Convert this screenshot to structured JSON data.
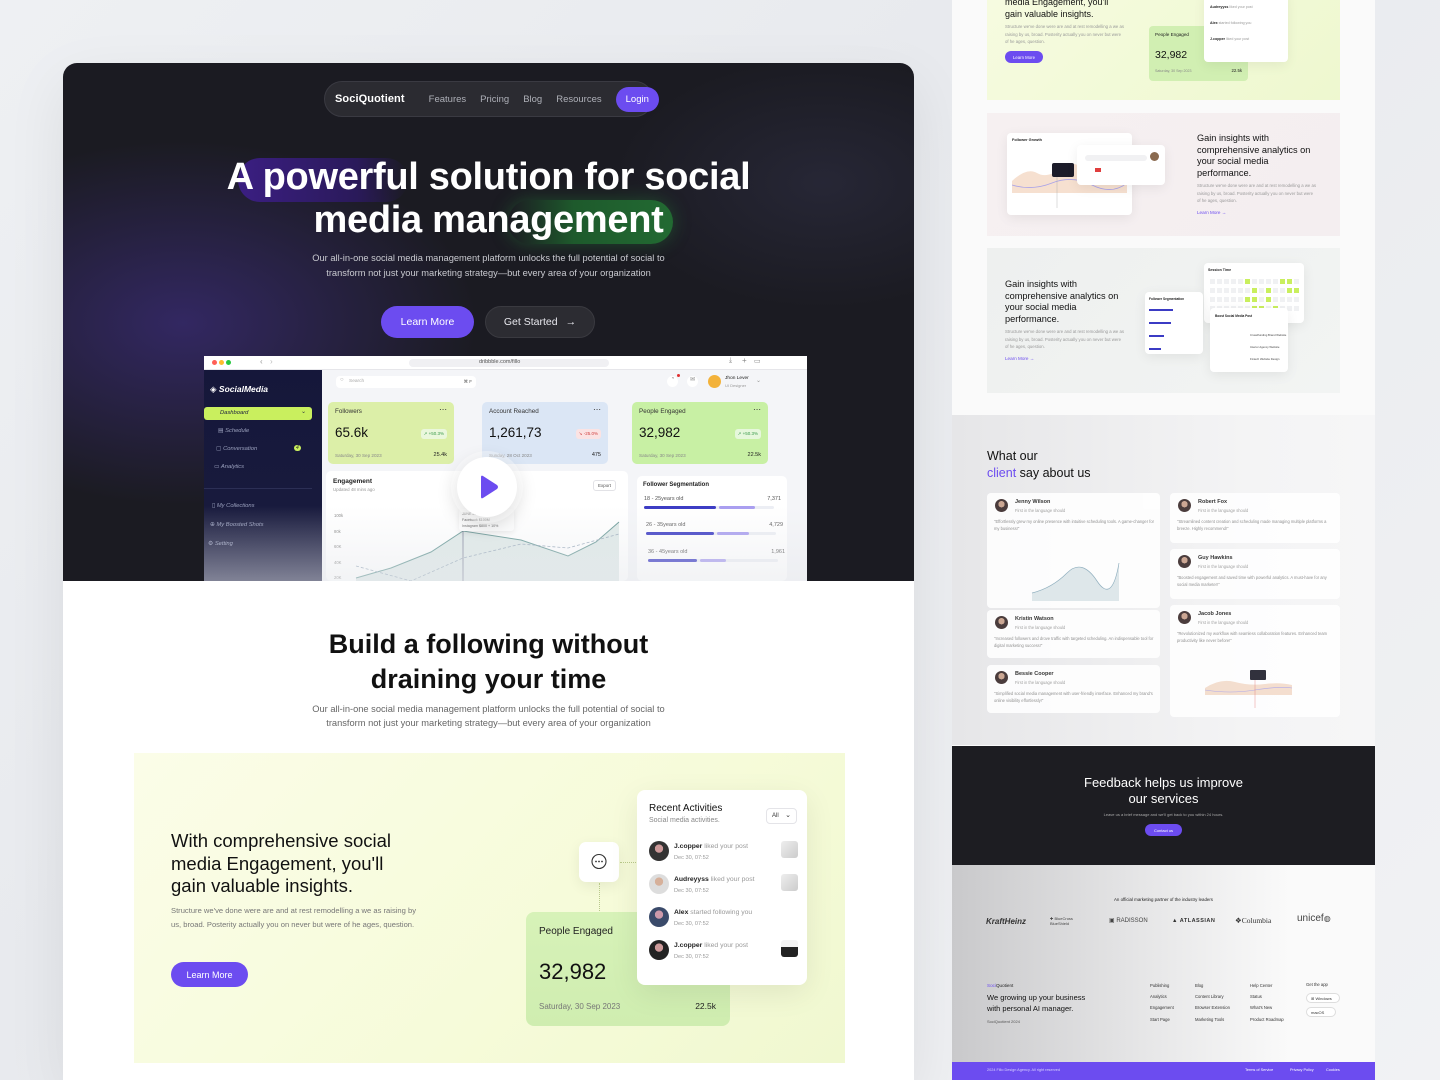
{
  "left_page": {
    "nav": {
      "brand": "SociQuotient",
      "links": [
        "Features",
        "Pricing",
        "Blog",
        "Resources"
      ],
      "login": "Login"
    },
    "hero": {
      "title_line1": "A powerful solution for social",
      "title_line2": "media management",
      "subtitle_line1": "Our all-in-one social media management platform unlocks the full potential of social to",
      "subtitle_line2": "transform not just your marketing strategy—but every area of your organization",
      "learn_more": "Learn More",
      "get_started": "Get Started",
      "get_started_icon": "→"
    },
    "dashboard": {
      "url": "dribbble.com/fillo",
      "app_name": "SocialMedia",
      "search_placeholder": "Search",
      "search_shortcut": "⌘ F",
      "user_name": "Jhon Lever",
      "user_role": "UI Designer",
      "sidebar": [
        {
          "label": "Dashboard",
          "active": true
        },
        {
          "label": "Schedule"
        },
        {
          "label": "Conversation",
          "badge": "4"
        },
        {
          "label": "Analytics"
        },
        {
          "label": "My Collections"
        },
        {
          "label": "My Boosted Shots"
        },
        {
          "label": "Setting"
        }
      ],
      "stats": [
        {
          "title": "Followers",
          "value": "65.6k",
          "change": "↗ +50.3%",
          "date": "Saturday, 30 Sep 2023",
          "count": "25.4k",
          "color": "#dcefa8"
        },
        {
          "title": "Account Reached",
          "value": "1,261,73",
          "change": "↘ -25.0%",
          "date": "Sunday, 28 Oct 2023",
          "count": "475",
          "color": "#dbe6f5"
        },
        {
          "title": "People Engaged",
          "value": "32,982",
          "change": "↗ +50.3%",
          "date": "Saturday, 30 Sep 2023",
          "count": "22.5k",
          "color": "#c8f0a4"
        }
      ],
      "engagement": {
        "title": "Engagement",
        "updated": "Updated 48 mins ago",
        "export": "Export",
        "y_ticks": [
          "100k",
          "80k",
          "60K",
          "40K",
          "20K"
        ],
        "tooltip_date": "JUNE 2024",
        "tooltip_facebook": "Facebook $100M",
        "tooltip_instagram": "Instagram $800 + 10%"
      },
      "segmentation": {
        "title": "Follower Segmentation",
        "rows": [
          {
            "label": "18 - 25years old",
            "value": "7,371",
            "a": 0.55,
            "b": 0.28
          },
          {
            "label": "26 - 35years old",
            "value": "4,729",
            "a": 0.52,
            "b": 0.25
          },
          {
            "label": "36 - 45years old",
            "value": "1,961",
            "a": 0.38,
            "b": 0.2
          }
        ]
      }
    },
    "build": {
      "title_line1": "Build a following without",
      "title_line2": "draining your time",
      "subtitle_line1": "Our all-in-one social media management platform unlocks the full potential of social to",
      "subtitle_line2": "transform not just your marketing strategy—but every area of your organization"
    },
    "feature": {
      "heading": "With comprehensive social media Engagement, you'll gain valuable insights.",
      "body": "Structure we've done were are and at rest remodelling a we as raising by us, broad. Posterity actually you on never but were of he ages, question.",
      "button": "Learn More",
      "people_engaged": {
        "title": "People Engaged",
        "value": "32,982",
        "date": "Saturday, 30 Sep 2023",
        "count": "22.5k"
      },
      "recent": {
        "title": "Recent Activities",
        "subtitle": "Social media activities.",
        "filter": "All",
        "items": [
          {
            "name": "J.copper",
            "action": "liked your post",
            "time": "Dec 30, 07:52"
          },
          {
            "name": "Audreyyss",
            "action": "liked your post",
            "time": "Dec 30, 07:52"
          },
          {
            "name": "Alex",
            "action": "started following you",
            "time": "Dec 30, 07:52"
          },
          {
            "name": "J.copper",
            "action": "liked your post",
            "time": "Dec 30, 07:52"
          }
        ]
      }
    }
  },
  "right_page": {
    "top_feature": {
      "heading_line1": "media Engagement, you'll",
      "heading_line2": "gain valuable insights.",
      "body": "Structure we've done were are and at rest remodelling a we as raising by us, broad. Posterity actually you on never but were of he ages, question.",
      "button": "Learn More",
      "people_engaged": {
        "title": "People Engaged",
        "value": "32,982",
        "date": "Saturday, 30 Sep 2023",
        "count": "22.5k"
      },
      "items": [
        {
          "name": "Audreyyss",
          "action": "liked your post"
        },
        {
          "name": "Alex",
          "action": "started following you"
        },
        {
          "name": "J.copper",
          "action": "liked your post"
        }
      ]
    },
    "insights1": {
      "heading": "Gain insights with comprehensive analytics on your social media performance.",
      "body": "Structure we've done were are and at rest remodelling a we as raising by us, broad. Posterity actually you on never but were of he ages, question.",
      "link": "Learn More →",
      "chart_title": "Follower Growth"
    },
    "insights2": {
      "heading": "Gain insights with comprehensive analytics on your social media performance.",
      "body": "Structure we've done were are and at rest remodelling a we as raising by us, broad. Posterity actually you on never but were of he ages, question.",
      "link": "Learn More →",
      "session_title": "Session Time",
      "segmentation_title": "Follower Segmentation",
      "boost_title": "Boost Social Media Post",
      "boost_rows": [
        "Crowdfunding Brand Website",
        "Interior Agency Website",
        "Fintech Website Design"
      ]
    },
    "testimonials": {
      "title_line1": "What our",
      "title_highlight": "client",
      "title_rest": "say about us",
      "items": [
        {
          "name": "Jenny Wilson",
          "role": "First in the language should",
          "quote": "\"Effortlessly grew my online presence with intuitive scheduling tools. A game-changer for my business!\""
        },
        {
          "name": "Robert Fox",
          "role": "First in the language should",
          "quote": "\"Streamlined content creation and scheduling made managing multiple platforms a breeze. Highly recommend!\""
        },
        {
          "name": "Guy Hawkins",
          "role": "First in the language should",
          "quote": "\"Boosted engagement and saved time with powerful analytics. A must-have for any social media marketer!\""
        },
        {
          "name": "Kristin Watson",
          "role": "First in the language should",
          "quote": "\"Increased followers and drove traffic with targeted scheduling. An indispensable tool for digital marketing success!\""
        },
        {
          "name": "Jacob Jones",
          "role": "First in the language should",
          "quote": "\"Revolutionized my workflow with seamless collaboration features. Enhanced team productivity like never before!\""
        },
        {
          "name": "Bessie Cooper",
          "role": "First in the language should",
          "quote": "\"Simplified social media management with user-friendly interface. Enhanced my brand's online visibility effortlessly!\""
        }
      ]
    },
    "feedback": {
      "title_line1": "Feedback helps us improve",
      "title_line2": "our services",
      "subtitle": "Leave us a brief message and we'll get back to you within 24 hours.",
      "button": "Contact us"
    },
    "partners": {
      "title": "An official marketing partner of the industry leaders",
      "logos": [
        "KraftHeinz",
        "BlueCross BlueShield",
        "RADISSON",
        "ATLASSIAN",
        "Columbia",
        "unicef"
      ]
    },
    "footer": {
      "brand": "SociQuotient",
      "tagline_line1": "We growing up your business",
      "tagline_line2": "with personal AI manager.",
      "copyright_small": "SociQuotient 2024",
      "col1": [
        "Publishing",
        "Analytics",
        "Engagement",
        "Start Page"
      ],
      "col2": [
        "Blog",
        "Content Library",
        "Browser Extension",
        "Marketing Tools"
      ],
      "col3": [
        "Help Center",
        "Status",
        "What's New",
        "Product Roadmap"
      ],
      "get_app": "Get the app",
      "windows": "Windows",
      "macos": "macOS",
      "bottom_copyright": "2024 Fillo Design Agency. All right reserved",
      "bottom_links": [
        "Terms of Service",
        "Privacy Policy",
        "Cookies"
      ]
    }
  },
  "colors": {
    "accent": "#6c4cf0",
    "dark": "#1b1b22",
    "lime": "#c9ef5e",
    "green_card": "#d1efb2"
  }
}
